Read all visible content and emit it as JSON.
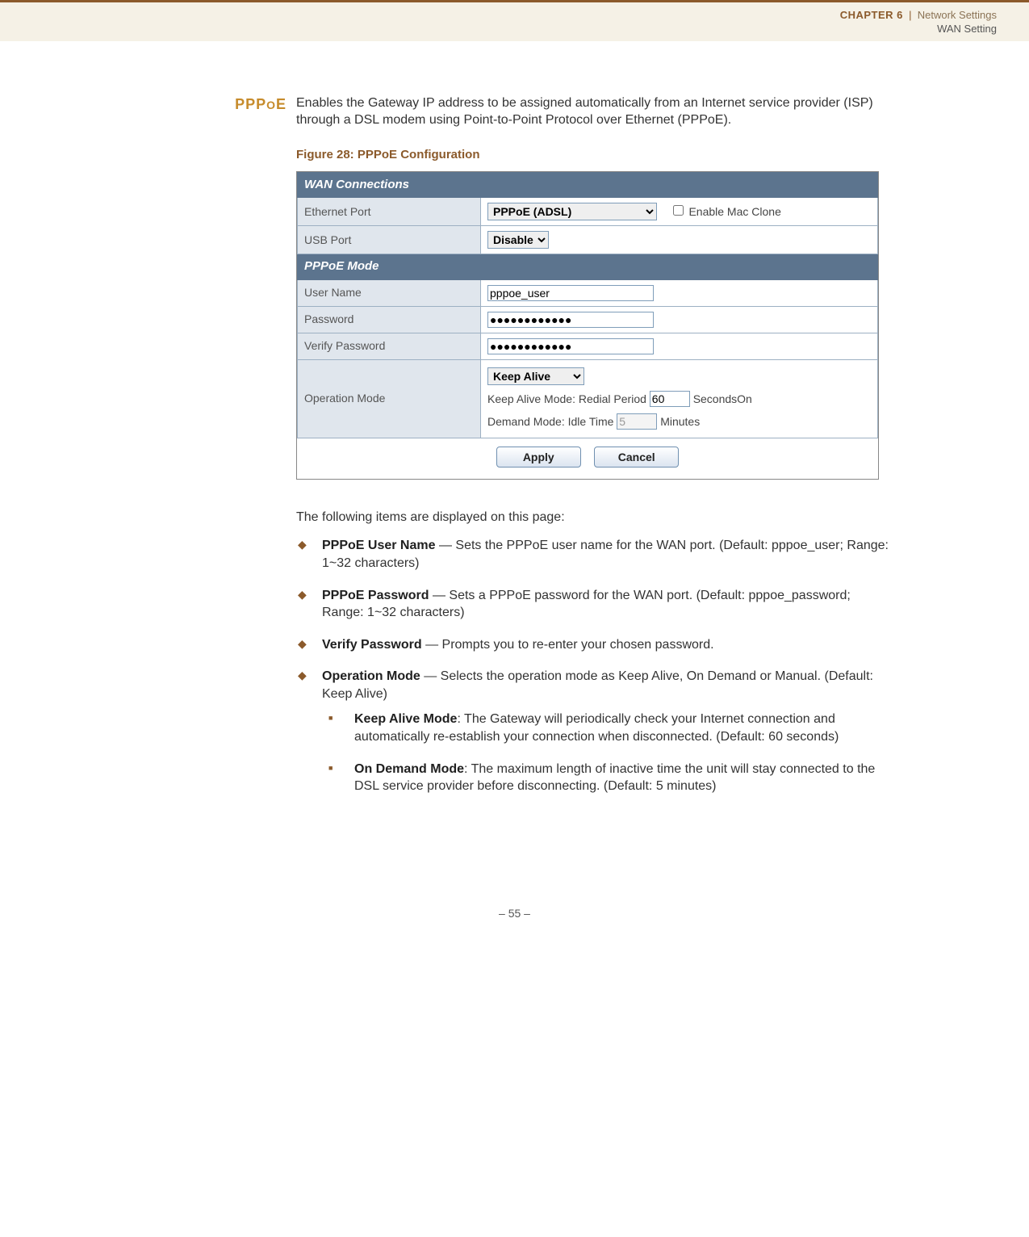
{
  "header": {
    "chapter": "CHAPTER 6",
    "sep": "|",
    "chapter_title": "Network Settings",
    "section": "WAN Setting"
  },
  "section_heading": {
    "main": "PPP",
    "sub": "O",
    "tail": "E"
  },
  "intro": "Enables the Gateway IP address to be assigned automatically from an Internet service provider (ISP) through a DSL modem using Point-to-Point Protocol over Ethernet (PPPoE).",
  "figure": {
    "caption": "Figure 28:  PPPoE Configuration"
  },
  "form": {
    "sections": {
      "wan": "WAN Connections",
      "pppoe": "PPPoE Mode"
    },
    "labels": {
      "eth": "Ethernet Port",
      "usb": "USB Port",
      "user": "User Name",
      "pass": "Password",
      "verify": "Verify Password",
      "op": "Operation Mode",
      "enable_mac": "Enable Mac Clone"
    },
    "values": {
      "eth_select": "PPPoE (ADSL)",
      "usb_select": "Disable",
      "user": "pppoe_user",
      "pass": "●●●●●●●●●●●●",
      "verify": "●●●●●●●●●●●●",
      "op_mode": "Keep Alive",
      "redial": "60",
      "idle": "5"
    },
    "inline": {
      "redial_label": "Keep Alive Mode: Redial Period",
      "redial_unit_join": "SecondsOn",
      "idle_label": "Demand Mode: Idle Time",
      "idle_unit": "Minutes"
    },
    "buttons": {
      "apply": "Apply",
      "cancel": "Cancel"
    }
  },
  "after_intro": "The following items are displayed on this page:",
  "items": {
    "i1_label": "PPPoE User Name",
    "i1_text": " — Sets the PPPoE user name for the WAN port. (Default: pppoe_user; Range: 1~32 characters)",
    "i2_label": "PPPoE Password",
    "i2_text": " — Sets a PPPoE password for the WAN port. (Default: pppoe_password; Range: 1~32 characters)",
    "i3_label": "Verify Password",
    "i3_text": " — Prompts you to re-enter your chosen password.",
    "i4_label": "Operation Mode",
    "i4_text": " — Selects the operation mode as Keep Alive, On Demand or Manual. (Default: Keep Alive)",
    "s1_label": "Keep Alive Mode",
    "s1_text": ": The Gateway will periodically check your Internet connection and automatically re-establish your connection when disconnected. (Default: 60 seconds)",
    "s2_label": "On Demand Mode",
    "s2_text": ": The maximum length of inactive time the unit will stay connected to the DSL service provider before disconnecting. (Default: 5 minutes)"
  },
  "page_number": "–  55  –"
}
